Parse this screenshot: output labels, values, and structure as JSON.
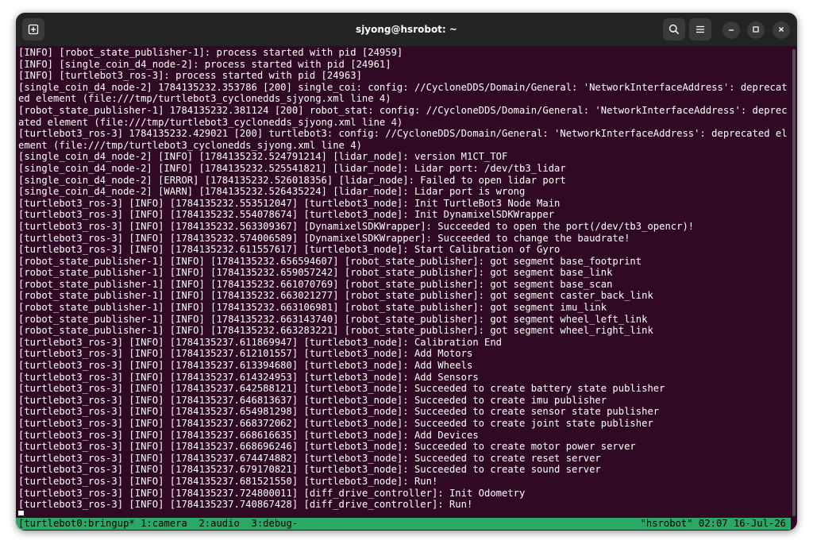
{
  "window": {
    "title": "sjyong@hsrobot: ~"
  },
  "terminal": {
    "lines": [
      "[INFO] [robot_state_publisher-1]: process started with pid [24959]",
      "[INFO] [single_coin_d4_node-2]: process started with pid [24961]",
      "[INFO] [turtlebot3_ros-3]: process started with pid [24963]",
      "[single_coin_d4_node-2] 1784135232.353786 [200] single_coi: config: //CycloneDDS/Domain/General: 'NetworkInterfaceAddress': deprecated element (file:///tmp/turtlebot3_cyclonedds_sjyong.xml line 4)",
      "[robot_state_publisher-1] 1784135232.381124 [200] robot_stat: config: //CycloneDDS/Domain/General: 'NetworkInterfaceAddress': deprecated element (file:///tmp/turtlebot3_cyclonedds_sjyong.xml line 4)",
      "[turtlebot3_ros-3] 1784135232.429021 [200] turtlebot3: config: //CycloneDDS/Domain/General: 'NetworkInterfaceAddress': deprecated element (file:///tmp/turtlebot3_cyclonedds_sjyong.xml line 4)",
      "[single_coin_d4_node-2] [INFO] [1784135232.524791214] [lidar_node]: version M1CT_TOF",
      "[single_coin_d4_node-2] [INFO] [1784135232.525541821] [lidar_node]: Lidar port: /dev/tb3_lidar",
      "[single_coin_d4_node-2] [ERROR] [1784135232.526018356] [lidar_node]: Failed to open lidar port",
      "[single_coin_d4_node-2] [WARN] [1784135232.526435224] [lidar_node]: Lidar port is wrong",
      "[turtlebot3_ros-3] [INFO] [1784135232.553512047] [turtlebot3_node]: Init TurtleBot3 Node Main",
      "[turtlebot3_ros-3] [INFO] [1784135232.554078674] [turtlebot3_node]: Init DynamixelSDKWrapper",
      "[turtlebot3_ros-3] [INFO] [1784135232.563309367] [DynamixelSDKWrapper]: Succeeded to open the port(/dev/tb3_opencr)!",
      "[turtlebot3_ros-3] [INFO] [1784135232.574006589] [DynamixelSDKWrapper]: Succeeded to change the baudrate!",
      "[turtlebot3_ros-3] [INFO] [1784135232.611557617] [turtlebot3_node]: Start Calibration of Gyro",
      "[robot_state_publisher-1] [INFO] [1784135232.656594607] [robot_state_publisher]: got segment base_footprint",
      "[robot_state_publisher-1] [INFO] [1784135232.659057242] [robot_state_publisher]: got segment base_link",
      "[robot_state_publisher-1] [INFO] [1784135232.661070769] [robot_state_publisher]: got segment base_scan",
      "[robot_state_publisher-1] [INFO] [1784135232.663021277] [robot_state_publisher]: got segment caster_back_link",
      "[robot_state_publisher-1] [INFO] [1784135232.663106981] [robot_state_publisher]: got segment imu_link",
      "[robot_state_publisher-1] [INFO] [1784135232.663143740] [robot_state_publisher]: got segment wheel_left_link",
      "[robot_state_publisher-1] [INFO] [1784135232.663283221] [robot_state_publisher]: got segment wheel_right_link",
      "[turtlebot3_ros-3] [INFO] [1784135237.611869947] [turtlebot3_node]: Calibration End",
      "[turtlebot3_ros-3] [INFO] [1784135237.612101557] [turtlebot3_node]: Add Motors",
      "[turtlebot3_ros-3] [INFO] [1784135237.613394680] [turtlebot3_node]: Add Wheels",
      "[turtlebot3_ros-3] [INFO] [1784135237.614324953] [turtlebot3_node]: Add Sensors",
      "[turtlebot3_ros-3] [INFO] [1784135237.642588121] [turtlebot3_node]: Succeeded to create battery state publisher",
      "[turtlebot3_ros-3] [INFO] [1784135237.646813637] [turtlebot3_node]: Succeeded to create imu publisher",
      "[turtlebot3_ros-3] [INFO] [1784135237.654981298] [turtlebot3_node]: Succeeded to create sensor state publisher",
      "[turtlebot3_ros-3] [INFO] [1784135237.668372062] [turtlebot3_node]: Succeeded to create joint state publisher",
      "[turtlebot3_ros-3] [INFO] [1784135237.668616635] [turtlebot3_node]: Add Devices",
      "[turtlebot3_ros-3] [INFO] [1784135237.668696246] [turtlebot3_node]: Succeeded to create motor power server",
      "[turtlebot3_ros-3] [INFO] [1784135237.674474882] [turtlebot3_node]: Succeeded to create reset server",
      "[turtlebot3_ros-3] [INFO] [1784135237.679170821] [turtlebot3_node]: Succeeded to create sound server",
      "[turtlebot3_ros-3] [INFO] [1784135237.681521550] [turtlebot3_node]: Run!",
      "[turtlebot3_ros-3] [INFO] [1784135237.724800011] [diff_drive_controller]: Init Odometry",
      "[turtlebot3_ros-3] [INFO] [1784135237.740867428] [diff_drive_controller]: Run!"
    ]
  },
  "tmux": {
    "left": "[turtlebot0:bringup* 1:camera  2:audio  3:debug-",
    "right": "\"hsrobot\" 02:07 16-Jul-26"
  },
  "icons": {
    "new_tab": "new-tab-icon",
    "search": "search-icon",
    "menu": "hamburger-menu-icon",
    "minimize": "minimize-icon",
    "maximize": "maximize-icon",
    "close": "close-icon"
  },
  "colors": {
    "terminal_bg": "#300a24",
    "titlebar_bg": "#242424",
    "tmux_status_bg": "#2aa866",
    "text": "#ffffff"
  }
}
